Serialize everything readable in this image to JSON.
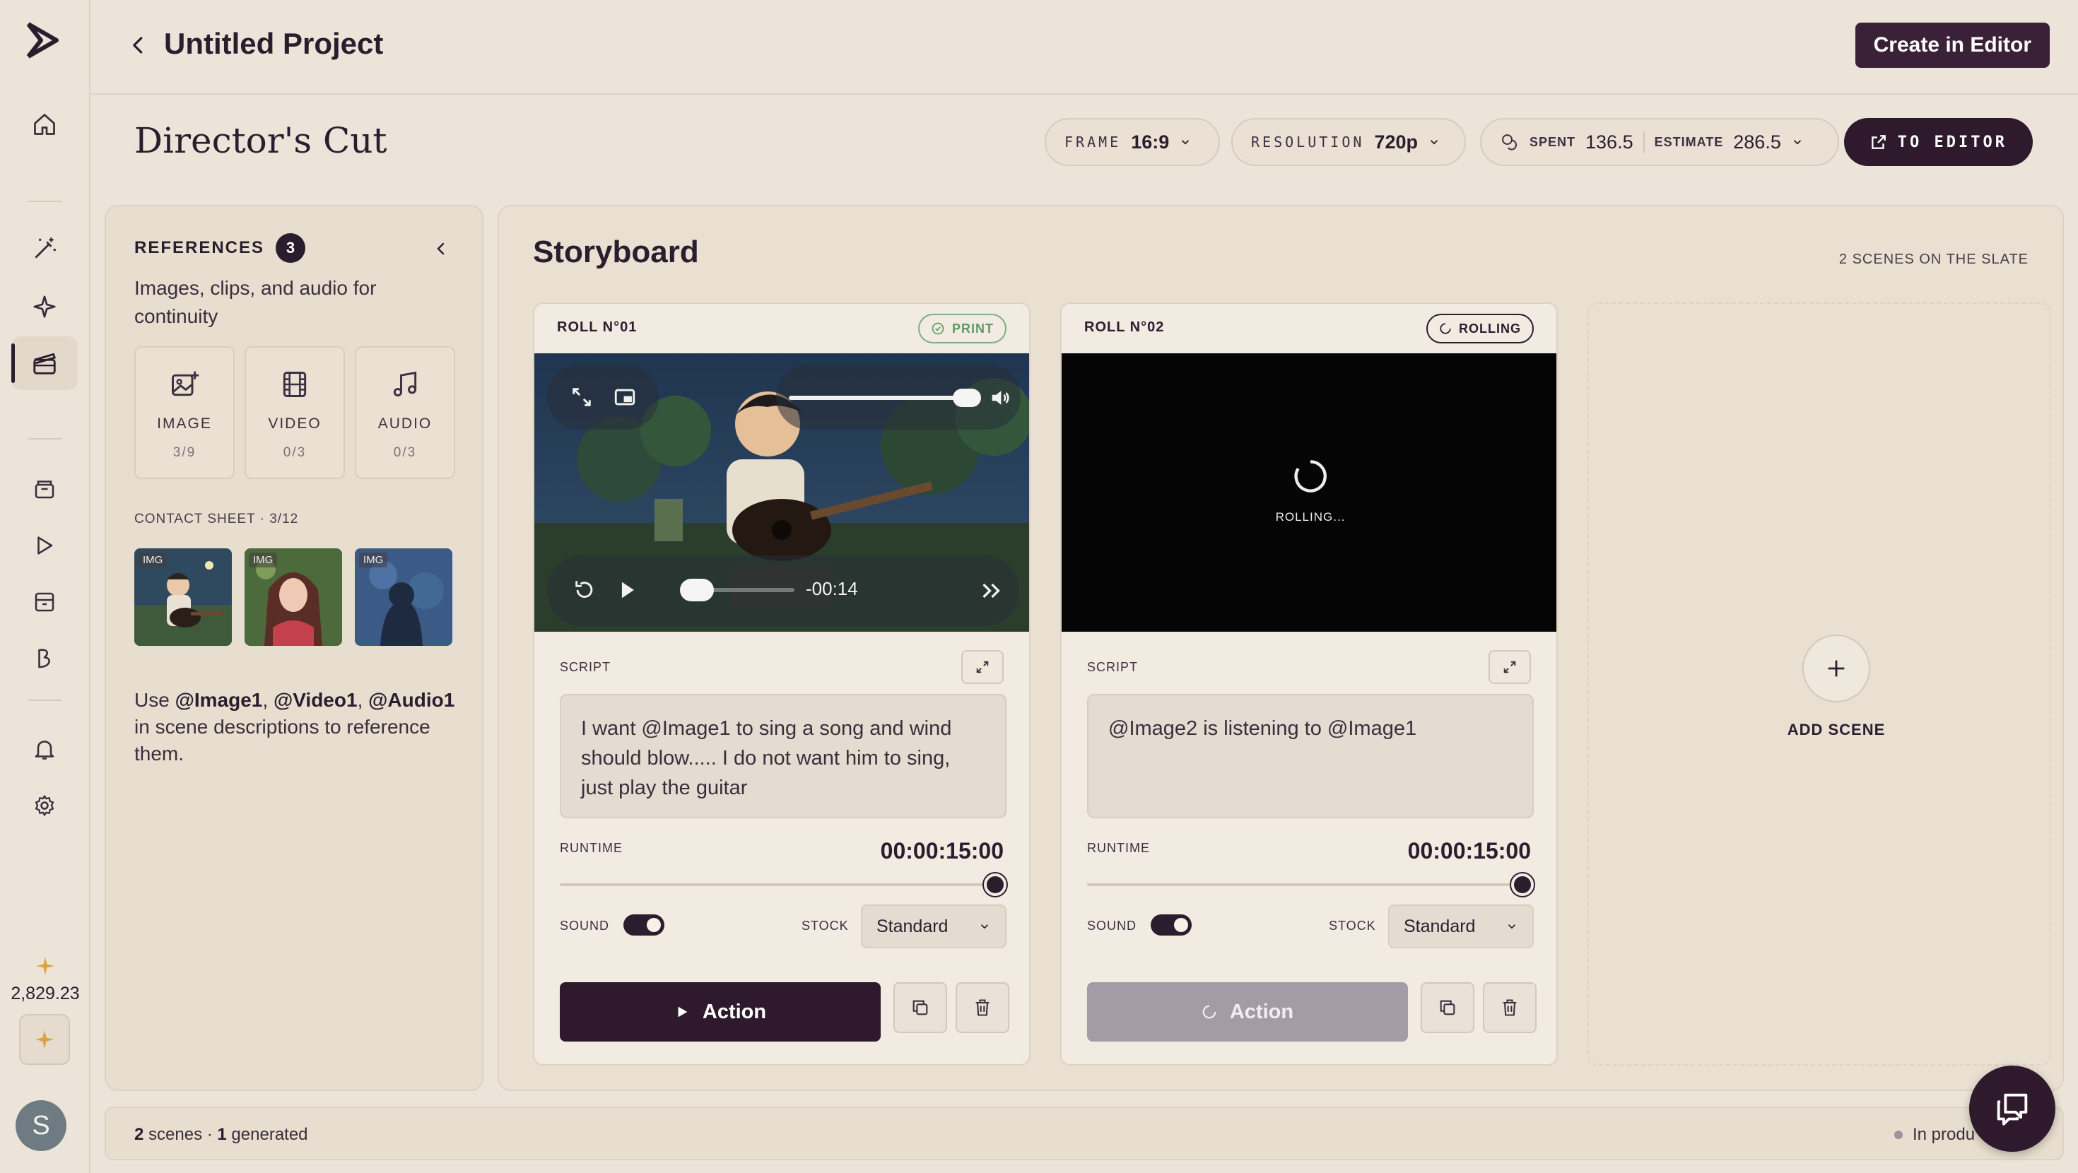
{
  "header": {
    "title": "Untitled Project",
    "create_label": "Create in Editor"
  },
  "subheader": {
    "title": "Director's Cut",
    "frame_label": "FRAME",
    "frame_value": "16:9",
    "resolution_label": "RESOLUTION",
    "resolution_value": "720p",
    "spent_label": "SPENT",
    "spent_value": "136.5",
    "estimate_label": "ESTIMATE",
    "estimate_value": "286.5",
    "to_editor_label": "TO EDITOR"
  },
  "sidebar": {
    "credits": "2,829.23",
    "avatar_initial": "S"
  },
  "references": {
    "title": "REFERENCES",
    "count": "3",
    "description": "Images, clips, and audio for continuity",
    "tiles": [
      {
        "name": "IMAGE",
        "count": "3/9"
      },
      {
        "name": "VIDEO",
        "count": "0/3"
      },
      {
        "name": "AUDIO",
        "count": "0/3"
      }
    ],
    "contact_sheet": "CONTACT SHEET · 3/12",
    "thumb_tag": "IMG",
    "note_prefix": "Use ",
    "note_image": "@Image1",
    "note_comma1": ", ",
    "note_video": "@Video1",
    "note_comma2": ", ",
    "note_audio": "@Audio1",
    "note_suffix": " in scene descriptions to reference them."
  },
  "storyboard": {
    "title": "Storyboard",
    "slate": "2 SCENES ON THE SLATE",
    "add_scene": "ADD SCENE",
    "scenes": [
      {
        "roll": "ROLL N°01",
        "status": "PRINT",
        "script_label": "SCRIPT",
        "script": "I want @Image1 to sing a song and wind should blow..... I do not want him to sing, just play the guitar",
        "runtime_label": "RUNTIME",
        "runtime": "00:00:15:00",
        "sound_label": "SOUND",
        "stock_label": "STOCK",
        "stock": "Standard",
        "action": "Action",
        "time_remaining": "-00:14"
      },
      {
        "roll": "ROLL N°02",
        "status": "ROLLING",
        "rolling_text": "ROLLING...",
        "script_label": "SCRIPT",
        "script": "@Image2 is listening to @Image1",
        "runtime_label": "RUNTIME",
        "runtime": "00:00:15:00",
        "sound_label": "SOUND",
        "stock_label": "STOCK",
        "stock": "Standard",
        "action": "Action"
      }
    ]
  },
  "footer": {
    "scenes_count": "2",
    "scenes_text": " scenes · ",
    "generated_count": "1",
    "generated_text": " generated",
    "status": "In produ"
  },
  "colors": {
    "accent": "#2E1A2C",
    "background": "#ECE4D8",
    "print_green": "#5E9A67",
    "spark_gold": "#D9A441"
  }
}
